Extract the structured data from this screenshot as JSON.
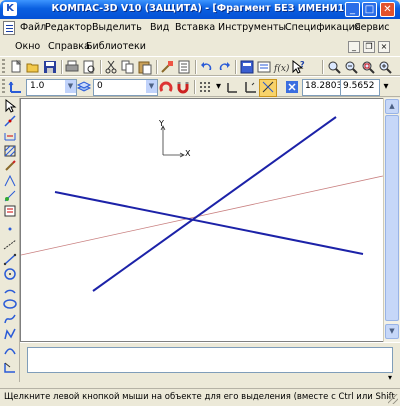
{
  "window": {
    "title": "КОМПАС-3D V10 (ЗАЩИТА) - [Фрагмент БЕЗ ИМЕНИ1]",
    "app_icon_glyph": "K",
    "controls": {
      "minimize": "_",
      "maximize": "□",
      "close": "✕"
    }
  },
  "menu": {
    "row1": [
      "Файл",
      "Редактор",
      "Выделить",
      "Вид",
      "Вставка",
      "Инструменты",
      "Спецификация",
      "Сервис"
    ],
    "row2": [
      "Окно",
      "Справка",
      "Библиотеки"
    ],
    "doc_controls": {
      "minimize": "_",
      "restore": "❐",
      "close": "×"
    }
  },
  "toolbar_standard": {
    "icons": [
      "new-icon",
      "open-icon",
      "save-icon",
      "print-icon",
      "preview-icon",
      "cut-icon",
      "copy-icon",
      "paste-icon",
      "format-icon",
      "properties-icon",
      "undo-icon",
      "redo-icon",
      "manager-icon",
      "layers-icon",
      "variables-icon",
      "help-pointer-icon",
      "zoom-in-icon",
      "zoom-out-icon",
      "zoom-window-icon",
      "zoom-all-icon"
    ]
  },
  "toolbar_current": {
    "scale": "1.0",
    "layer": "0",
    "coord_x": "18.2803",
    "coord_y": "9.5652"
  },
  "status": {
    "text": "Щелкните левой кнопкой мыши на объекте для его выделения (вместе с Ctrl или Shift"
  },
  "canvas": {
    "axis_labels": {
      "x": "X",
      "y": "Y"
    },
    "line_color": "#1c22a8",
    "aux_line_color": "#c98080"
  },
  "colors": {
    "accent": "#0a5fe0",
    "close": "#e1522c"
  }
}
